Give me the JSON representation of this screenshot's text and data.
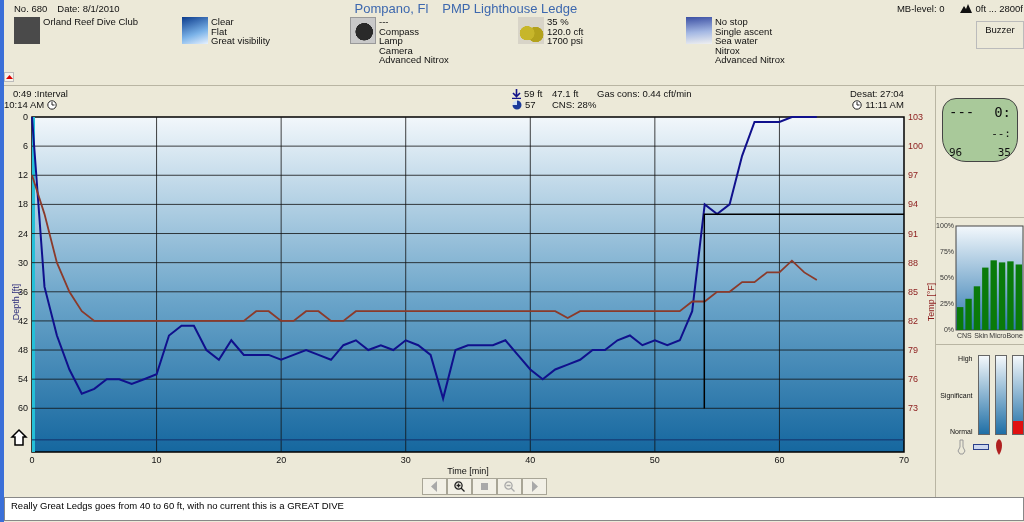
{
  "header": {
    "number": "No. 680",
    "date": "Date: 8/1/2010",
    "location": "Pompano, Fl",
    "site": "PMP Lighthouse Ledge",
    "mb_level": "MB-level: 0",
    "altitude": "0ft ... 2800f"
  },
  "info_groups": [
    {
      "kind": "buddies",
      "lines": [
        "Orland Reef Dive Club"
      ]
    },
    {
      "kind": "weather",
      "lines": [
        "Clear",
        "Flat",
        "Great visibility"
      ]
    },
    {
      "kind": "equipment",
      "lines": [
        "---",
        "Compass",
        "Lamp",
        "Camera",
        "Advanced Nitrox"
      ]
    },
    {
      "kind": "tanks",
      "lines": [
        "35 %",
        "120.0 cft",
        "1700 psi"
      ]
    },
    {
      "kind": "dive_type",
      "lines": [
        "No stop",
        "Single ascent",
        "Sea water",
        "Nitrox",
        "Advanced Nitrox"
      ]
    }
  ],
  "buzzer": "Buzzer",
  "stats": {
    "interval": "0:49 :Interval",
    "start_time": "10:14 AM",
    "max_depth": "59 ft",
    "min_temp": "57",
    "avg_depth": "47.1 ft",
    "cns": "CNS: 28%",
    "gas_consumption": "Gas cons: 0.44 cft/min",
    "desat": "Desat: 27:04",
    "end_time": "11:11 AM"
  },
  "profile": {
    "chart_data": {
      "type": "line",
      "xlabel": "Time [min]",
      "ylabel": "Depth [ft]",
      "y2label": "Temp [°F]",
      "xlim": [
        0,
        70
      ],
      "ylim": [
        69,
        0
      ],
      "y2lim": [
        68.5,
        103
      ],
      "grid": true,
      "ref_lines": [
        {
          "axis": "y",
          "value": 66.5,
          "color": "#14306a"
        }
      ],
      "bands": [
        {
          "axis": "x",
          "from": 0,
          "to": 0.24,
          "color": "#25c0d8"
        }
      ],
      "xticks": [
        0,
        10,
        20,
        30,
        40,
        50,
        60,
        70
      ],
      "yticks": [
        0,
        6,
        12,
        18,
        24,
        30,
        36,
        42,
        48,
        54,
        60
      ],
      "y2ticks": [
        73,
        76,
        79,
        82,
        85,
        88,
        91,
        94,
        97,
        100,
        103
      ],
      "x": [
        0,
        1,
        2,
        3,
        4,
        5,
        6,
        7,
        8,
        9,
        10,
        11,
        12,
        13,
        14,
        15,
        16,
        17,
        18,
        19,
        20,
        21,
        22,
        23,
        24,
        25,
        26,
        27,
        28,
        29,
        30,
        31,
        32,
        33,
        34,
        35,
        36,
        37,
        38,
        39,
        40,
        41,
        42,
        43,
        44,
        45,
        46,
        47,
        48,
        49,
        50,
        51,
        52,
        53,
        54,
        55,
        56,
        57,
        58,
        59,
        60,
        61,
        62,
        63
      ],
      "series": [
        {
          "color": "#10108c",
          "values": [
            0,
            35,
            45,
            52,
            57,
            56,
            54,
            54,
            55,
            54,
            53,
            45,
            43,
            43,
            48,
            50,
            46,
            49,
            49,
            49,
            50,
            49,
            48,
            49,
            50,
            47,
            46,
            48,
            47,
            48,
            46,
            47,
            49,
            58,
            48,
            47,
            47,
            47,
            46,
            49,
            52,
            54,
            52,
            51,
            50,
            48,
            48,
            46,
            45,
            47,
            46,
            47,
            46,
            40,
            18,
            20,
            18,
            8,
            1,
            1,
            1,
            0,
            0,
            0
          ]
        },
        {
          "color": "#8b3a2a",
          "axis": "y2",
          "values": [
            97,
            93,
            88,
            85,
            83,
            82,
            82,
            82,
            82,
            82,
            82,
            82,
            82,
            82,
            82,
            82,
            82,
            82,
            83,
            83,
            82,
            82,
            83,
            83,
            82,
            82,
            83,
            83,
            83,
            83,
            83,
            83,
            83,
            83,
            83,
            83,
            83,
            83,
            83,
            83,
            83,
            83,
            83,
            82.3,
            83,
            83,
            83,
            83,
            83,
            83,
            83,
            83,
            83,
            84,
            84,
            85,
            85,
            86,
            86,
            87,
            87,
            88.2,
            87,
            86.2
          ]
        }
      ]
    }
  },
  "nav_buttons": [
    {
      "kind": "prev",
      "disabled": true
    },
    {
      "kind": "zoom_in",
      "disabled": false
    },
    {
      "kind": "stop",
      "disabled": true
    },
    {
      "kind": "zoom_out",
      "disabled": true
    },
    {
      "kind": "next",
      "disabled": true
    }
  ],
  "computer_display": {
    "depth": "---",
    "time": "0:",
    "stop": "--:",
    "temp": "96",
    "o2": "35"
  },
  "tissue_chart": {
    "chart_data": {
      "type": "bar",
      "categories": [
        "CNS",
        null,
        "Skin",
        null,
        "Micro",
        null,
        "Bone",
        null
      ],
      "ylim": [
        0,
        100
      ],
      "yticks": [
        {
          "value": 0,
          "label": "0%"
        },
        {
          "value": 25,
          "label": "25%"
        },
        {
          "value": 50,
          "label": "50%"
        },
        {
          "value": 75,
          "label": "75%"
        },
        {
          "value": 100,
          "label": "100%"
        }
      ],
      "series": [
        {
          "color": "#0a7a0a",
          "values": [
            22,
            30,
            42,
            60,
            67,
            65,
            66,
            63
          ]
        }
      ]
    }
  },
  "gauges": {
    "labels": [
      "High",
      "Significant",
      "Normal"
    ],
    "items": [
      {
        "level": 0
      },
      {
        "level": 0
      },
      {
        "level": 0.17
      }
    ]
  },
  "notes": "Really Great Ledgs goes from 40 to 60 ft, with no current this is a GREAT DIVE"
}
